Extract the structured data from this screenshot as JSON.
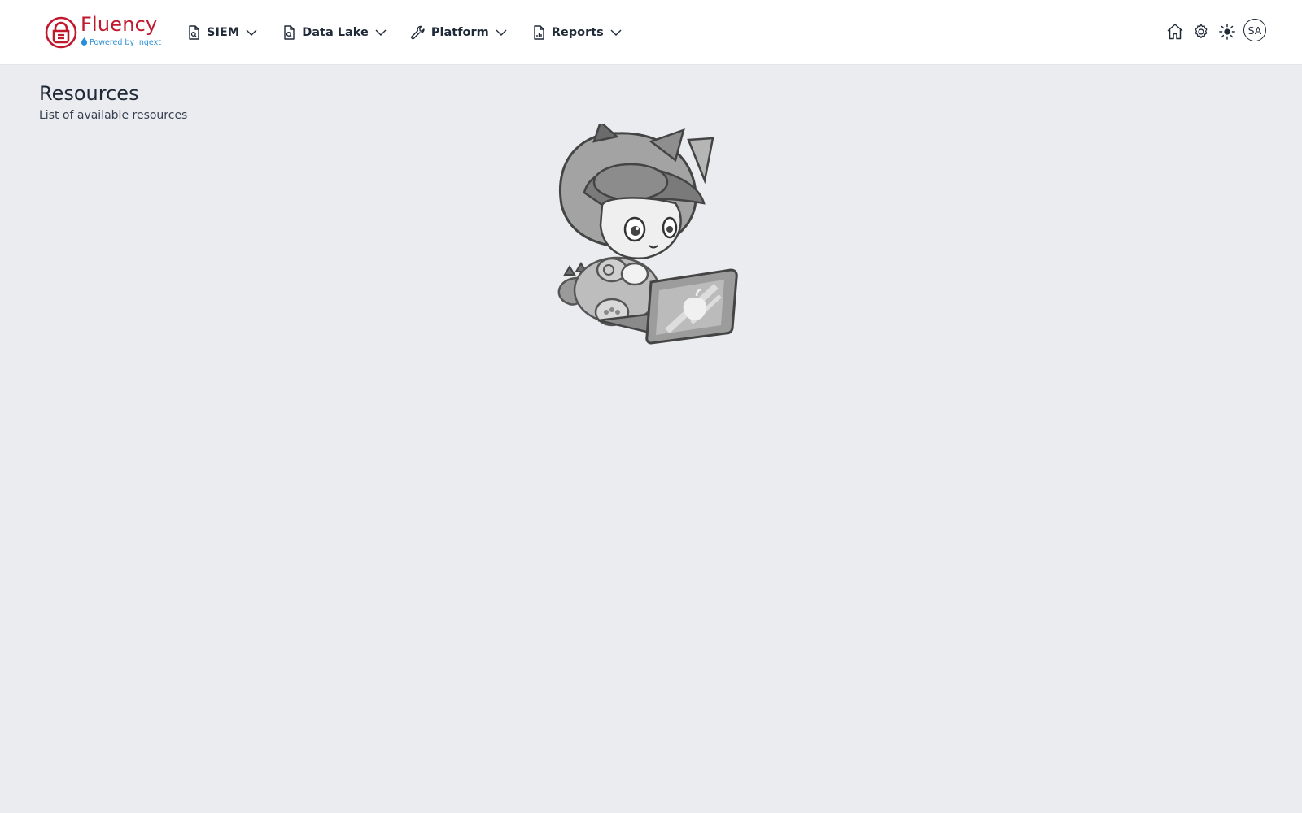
{
  "brand": {
    "name": "Fluency",
    "tagline": "Powered by Ingext",
    "brand_color": "#c0192e",
    "tagline_color": "#2b8fd6"
  },
  "nav": {
    "items": [
      {
        "label": "SIEM",
        "icon": "document-search-icon"
      },
      {
        "label": "Data Lake",
        "icon": "document-search-icon"
      },
      {
        "label": "Platform",
        "icon": "wrench-icon"
      },
      {
        "label": "Reports",
        "icon": "document-chart-icon"
      }
    ]
  },
  "toolbar": {
    "icons": [
      "home-icon",
      "gear-icon",
      "sun-icon"
    ],
    "avatar_initials": "SA"
  },
  "page": {
    "title": "Resources",
    "subtitle": "List of available resources",
    "illustration": "loading-mascot-cat-with-laptop"
  },
  "colors": {
    "background": "#ebecef",
    "header_bg": "#ffffff",
    "text": "#1f2937"
  }
}
